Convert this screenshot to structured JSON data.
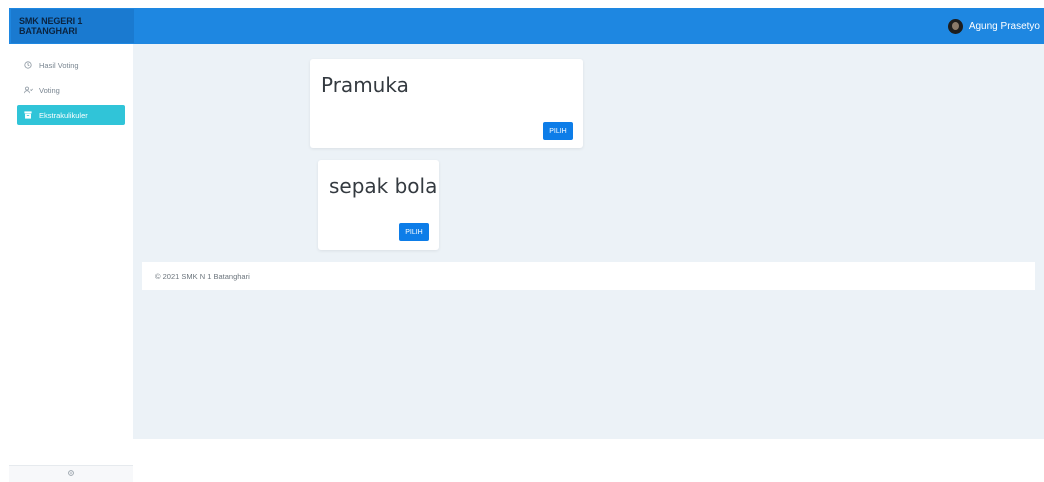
{
  "navbar": {
    "brand": "SMK NEGERI 1 BATANGHARI",
    "user_name": "Agung Prasetyo"
  },
  "sidebar": {
    "items": [
      {
        "label": "Hasil Voting",
        "icon": "clock-icon"
      },
      {
        "label": "Voting",
        "icon": "users-icon"
      },
      {
        "label": "Ekstrakulikuler",
        "icon": "archive-icon",
        "active": true
      }
    ],
    "footer_icon": "gear-icon"
  },
  "cards": [
    {
      "title": "Pramuka",
      "button_label": "PILIH"
    },
    {
      "title": "sepak bola",
      "button_label": "PILIH"
    }
  ],
  "footer": {
    "text": "© 2021 SMK N 1 Batanghari"
  },
  "colors": {
    "navbar": "#1e87e1",
    "active_menu": "#30c4d8",
    "button": "#0d7de8",
    "content_bg": "#ecf2f7"
  }
}
